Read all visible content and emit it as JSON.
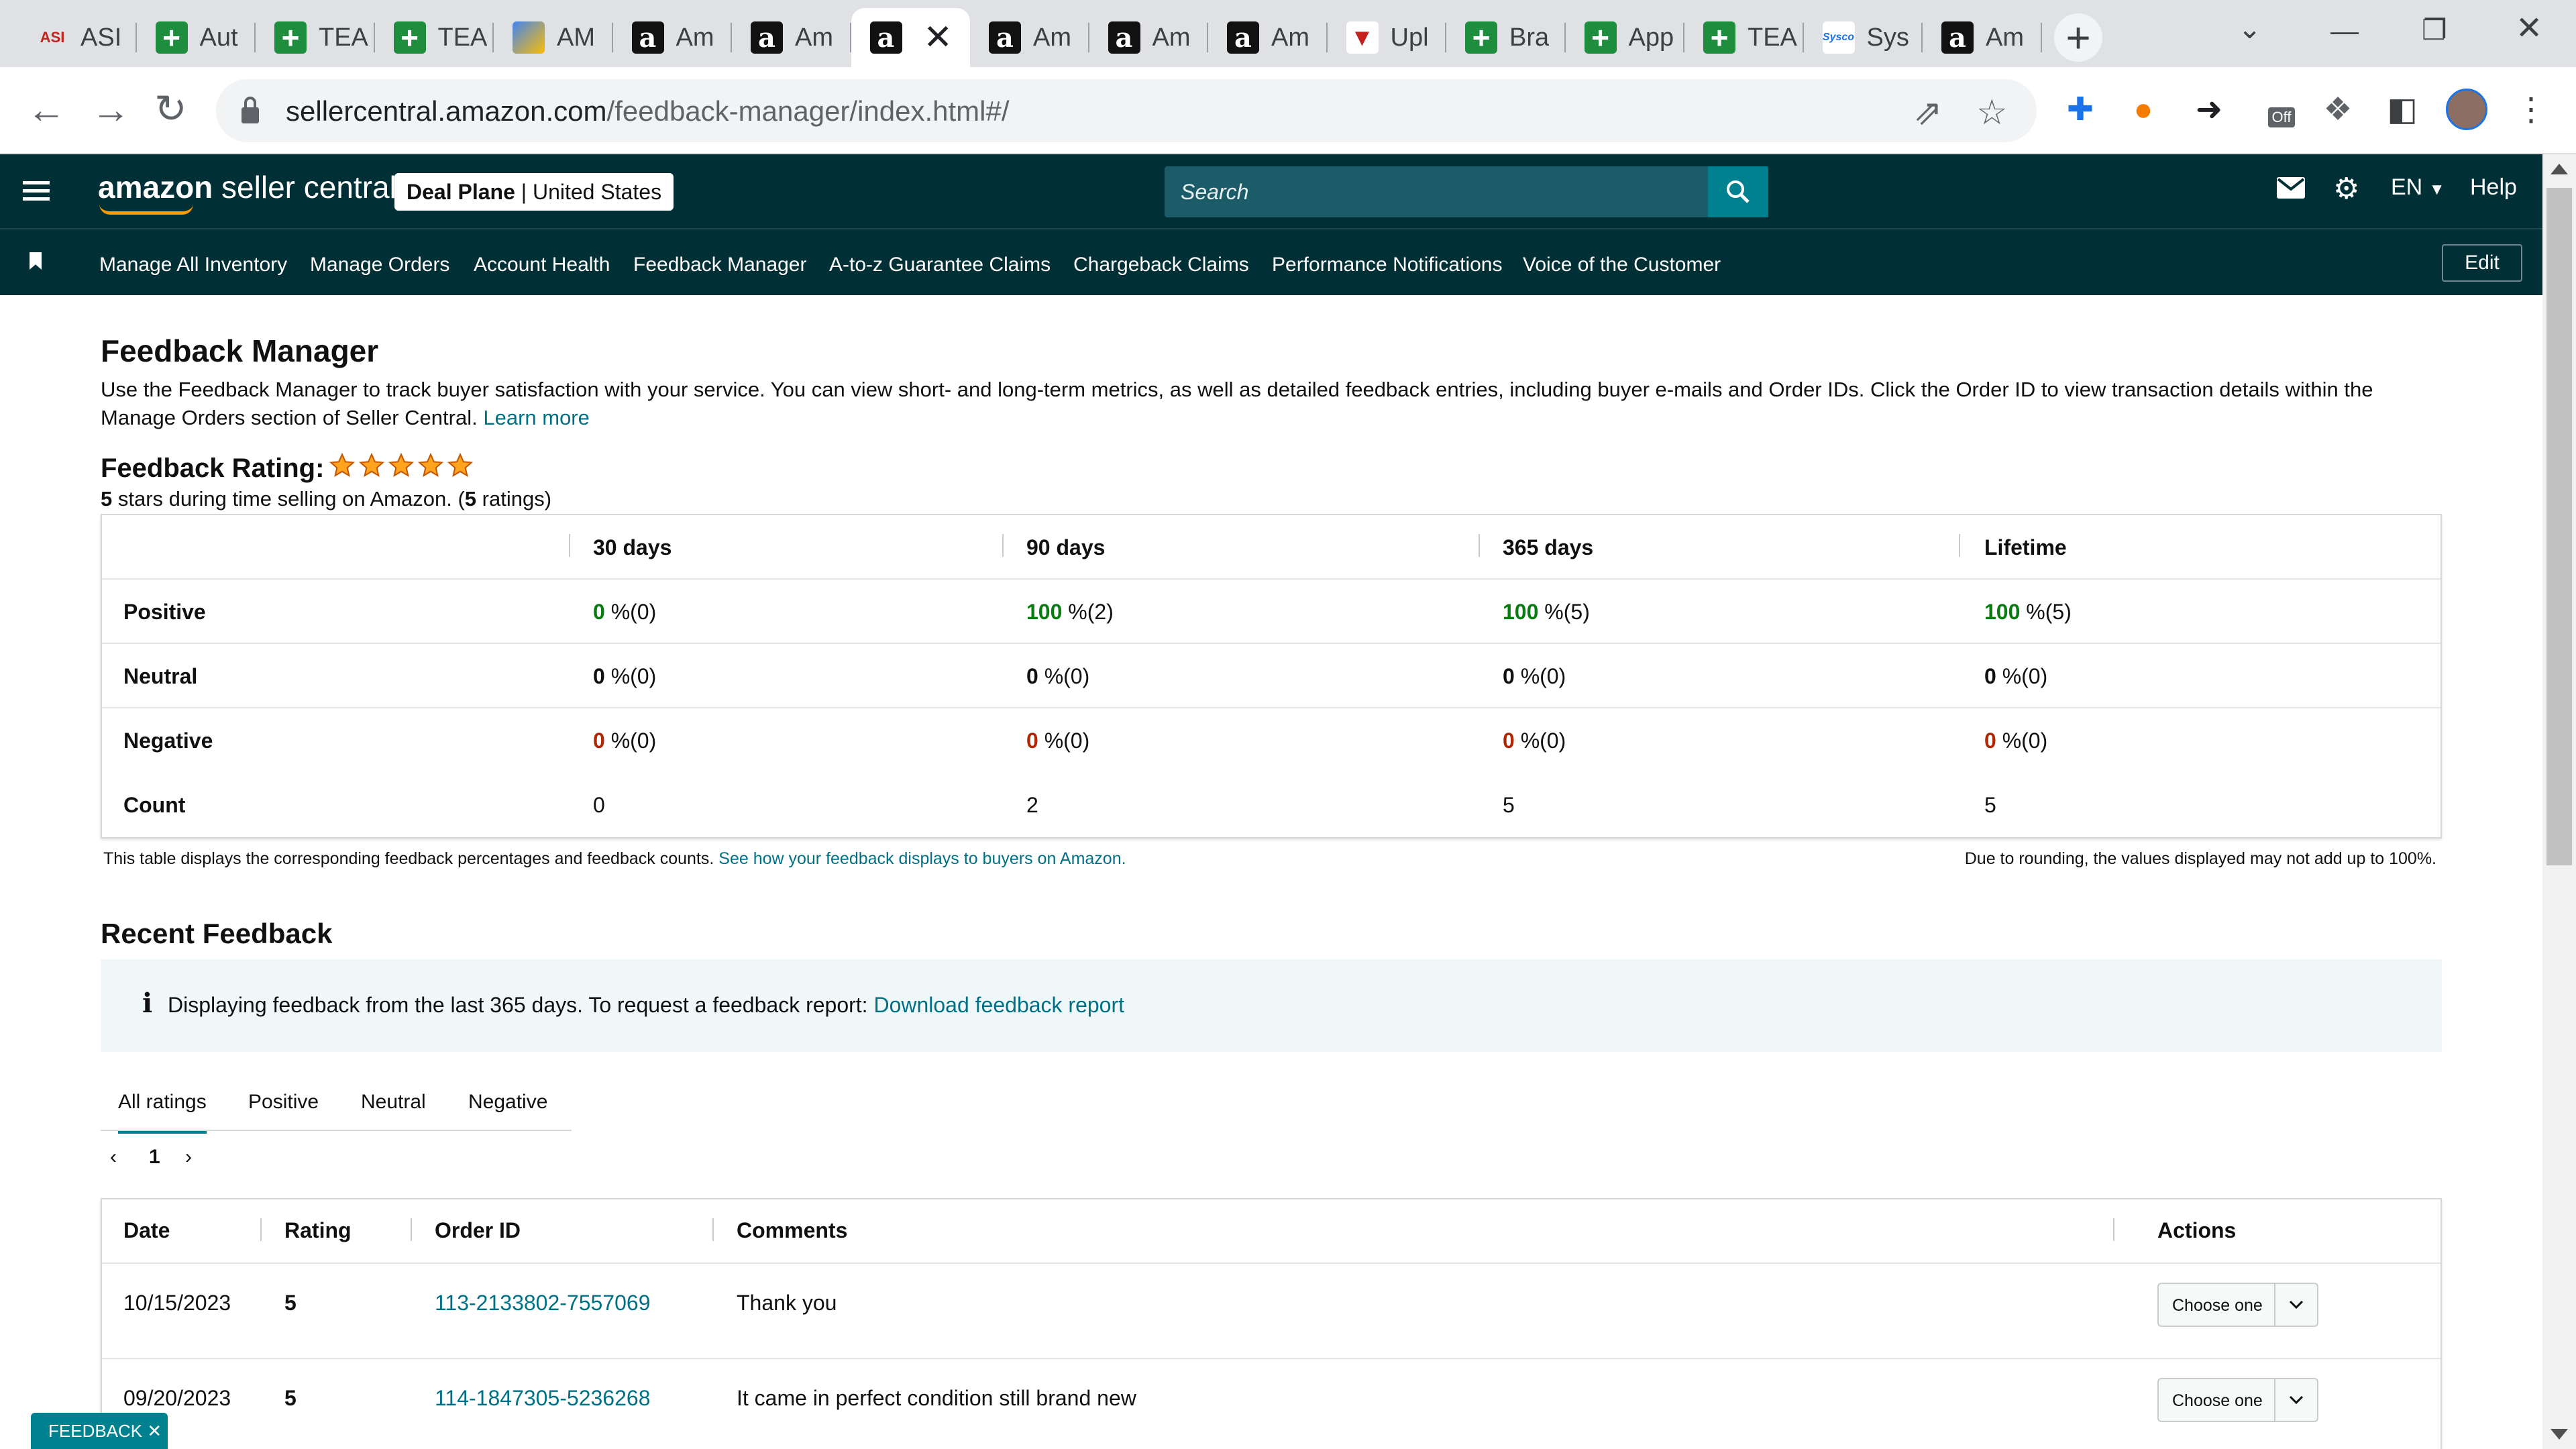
{
  "browser": {
    "tabs": [
      {
        "title": "ASI",
        "favicon": "asi-icon"
      },
      {
        "title": "Aut",
        "favicon": "plus-icon"
      },
      {
        "title": "TEA",
        "favicon": "plus-icon"
      },
      {
        "title": "TEA",
        "favicon": "plus-icon"
      },
      {
        "title": "AM",
        "favicon": "pencil-icon"
      },
      {
        "title": "Am",
        "favicon": "amazon-icon"
      },
      {
        "title": "Am",
        "favicon": "amazon-icon"
      },
      {
        "title": "",
        "favicon": "amazon-icon",
        "active": true
      },
      {
        "title": "Am",
        "favicon": "amazon-icon"
      },
      {
        "title": "Am",
        "favicon": "amazon-icon"
      },
      {
        "title": "Am",
        "favicon": "amazon-icon"
      },
      {
        "title": "Upl",
        "favicon": "shield-icon"
      },
      {
        "title": "Bra",
        "favicon": "plus-icon"
      },
      {
        "title": "App",
        "favicon": "plus-icon"
      },
      {
        "title": "TEA",
        "favicon": "plus-icon"
      },
      {
        "title": "Sys",
        "favicon": "sysco-icon"
      },
      {
        "title": "Am",
        "favicon": "amazon-icon"
      }
    ],
    "new_tab_label": "+",
    "close_tab_glyph": "✕",
    "url_host": "sellercentral.amazon.com",
    "url_path": "/feedback-manager/index.html#/",
    "extension_off_badge": "Off"
  },
  "header": {
    "logo_bold": "amazon",
    "logo_rest": " seller central",
    "store_name": "Deal Plane",
    "store_region": "United States",
    "search_placeholder": "Search",
    "language": "EN",
    "help_label": "Help"
  },
  "nav": {
    "links": [
      "Manage All Inventory",
      "Manage Orders",
      "Account Health",
      "Feedback Manager",
      "A-to-z Guarantee Claims",
      "Chargeback Claims",
      "Performance Notifications",
      "Voice of the Customer"
    ],
    "edit_label": "Edit"
  },
  "page": {
    "title": "Feedback Manager",
    "description": "Use the Feedback Manager to track buyer satisfaction with your service. You can view short- and long-term metrics, as well as detailed feedback entries, including buyer e-mails and Order IDs. Click the Order ID to view transaction details within the Manage Orders section of Seller Central.",
    "learn_more": "Learn more",
    "rating_heading": "Feedback Rating:",
    "rating_stars": 5,
    "rating_value": "5",
    "rating_text_mid": " stars during time selling on Amazon. (",
    "rating_count": "5",
    "rating_text_end": " ratings)"
  },
  "summary": {
    "columns": [
      "30 days",
      "90 days",
      "365 days",
      "Lifetime"
    ],
    "rows": [
      {
        "label": "Positive",
        "tone": "g",
        "cells": [
          [
            "0",
            " %(0)"
          ],
          [
            "100",
            " %(2)"
          ],
          [
            "100",
            " %(5)"
          ],
          [
            "100",
            " %(5)"
          ]
        ]
      },
      {
        "label": "Neutral",
        "tone": "k",
        "cells": [
          [
            "0",
            " %(0)"
          ],
          [
            "0",
            " %(0)"
          ],
          [
            "0",
            " %(0)"
          ],
          [
            "0",
            " %(0)"
          ]
        ]
      },
      {
        "label": "Negative",
        "tone": "r",
        "cells": [
          [
            "0",
            " %(0)"
          ],
          [
            "0",
            " %(0)"
          ],
          [
            "0",
            " %(0)"
          ],
          [
            "0",
            " %(0)"
          ]
        ]
      }
    ],
    "count_label": "Count",
    "counts": [
      "0",
      "2",
      "5",
      "5"
    ],
    "note": "This table displays the corresponding feedback percentages and feedback counts.",
    "note_link": "See how your feedback displays to buyers on Amazon.",
    "note_right": "Due to rounding, the values displayed may not add up to 100%."
  },
  "recent": {
    "title": "Recent Feedback",
    "info_text": "Displaying feedback from the last 365 days. To request a feedback report:",
    "info_link": "Download feedback report",
    "tabs": [
      "All ratings",
      "Positive",
      "Neutral",
      "Negative"
    ],
    "page_number": "1",
    "columns": [
      "Date",
      "Rating",
      "Order ID",
      "Comments",
      "Actions"
    ],
    "rows": [
      {
        "date": "10/15/2023",
        "rating": "5",
        "order_id": "113-2133802-7557069",
        "comment": "Thank you",
        "action": "Choose one"
      },
      {
        "date": "09/20/2023",
        "rating": "5",
        "order_id": "114-1847305-5236268",
        "comment": "It came in perfect condition still brand new",
        "action": "Choose one"
      }
    ]
  },
  "feedback_widget": {
    "label": "FEEDBACK",
    "close": "✕"
  },
  "colors": {
    "header_bg": "#002f36",
    "search_btn": "#00818f",
    "positive_green": "#067d0e",
    "negative_red": "#b12704",
    "link_teal": "#007185",
    "star_orange": "#ffa41c"
  }
}
